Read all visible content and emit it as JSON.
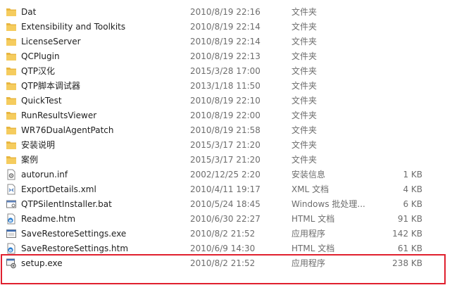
{
  "colors": {
    "highlight": "#e0202e",
    "folder": "#f2c453",
    "secondary_text": "#6d6d6d"
  },
  "files": [
    {
      "name": "Dat",
      "date": "2010/8/19 22:16",
      "type": "文件夹",
      "size": "",
      "icon": "folder-icon"
    },
    {
      "name": "Extensibility and Toolkits",
      "date": "2010/8/19 22:14",
      "type": "文件夹",
      "size": "",
      "icon": "folder-icon"
    },
    {
      "name": "LicenseServer",
      "date": "2010/8/19 22:14",
      "type": "文件夹",
      "size": "",
      "icon": "folder-icon"
    },
    {
      "name": "QCPlugin",
      "date": "2010/8/19 22:13",
      "type": "文件夹",
      "size": "",
      "icon": "folder-icon"
    },
    {
      "name": "QTP汉化",
      "date": "2015/3/28 17:00",
      "type": "文件夹",
      "size": "",
      "icon": "folder-icon"
    },
    {
      "name": "QTP脚本调试器",
      "date": "2013/1/18 11:50",
      "type": "文件夹",
      "size": "",
      "icon": "folder-icon"
    },
    {
      "name": "QuickTest",
      "date": "2010/8/19 22:10",
      "type": "文件夹",
      "size": "",
      "icon": "folder-icon"
    },
    {
      "name": "RunResultsViewer",
      "date": "2010/8/19 22:00",
      "type": "文件夹",
      "size": "",
      "icon": "folder-icon"
    },
    {
      "name": "WR76DualAgentPatch",
      "date": "2010/8/19 21:58",
      "type": "文件夹",
      "size": "",
      "icon": "folder-icon"
    },
    {
      "name": "安装说明",
      "date": "2015/3/17 21:20",
      "type": "文件夹",
      "size": "",
      "icon": "folder-icon"
    },
    {
      "name": "案例",
      "date": "2015/3/17 21:20",
      "type": "文件夹",
      "size": "",
      "icon": "folder-icon"
    },
    {
      "name": "autorun.inf",
      "date": "2002/12/25 2:20",
      "type": "安装信息",
      "size": "1 KB",
      "icon": "settings-file-icon"
    },
    {
      "name": "ExportDetails.xml",
      "date": "2010/4/11 19:17",
      "type": "XML 文档",
      "size": "4 KB",
      "icon": "xml-file-icon"
    },
    {
      "name": "QTPSilentInstaller.bat",
      "date": "2010/5/24 18:45",
      "type": "Windows 批处理...",
      "size": "6 KB",
      "icon": "batch-file-icon"
    },
    {
      "name": "Readme.htm",
      "date": "2010/6/30 22:27",
      "type": "HTML 文档",
      "size": "91 KB",
      "icon": "html-file-icon"
    },
    {
      "name": "SaveRestoreSettings.exe",
      "date": "2010/8/2 21:52",
      "type": "应用程序",
      "size": "142 KB",
      "icon": "application-icon"
    },
    {
      "name": "SaveRestoreSettings.htm",
      "date": "2010/6/9 14:30",
      "type": "HTML 文档",
      "size": "61 KB",
      "icon": "html-file-icon"
    },
    {
      "name": "setup.exe",
      "date": "2010/8/2 21:52",
      "type": "应用程序",
      "size": "238 KB",
      "icon": "setup-icon"
    }
  ]
}
